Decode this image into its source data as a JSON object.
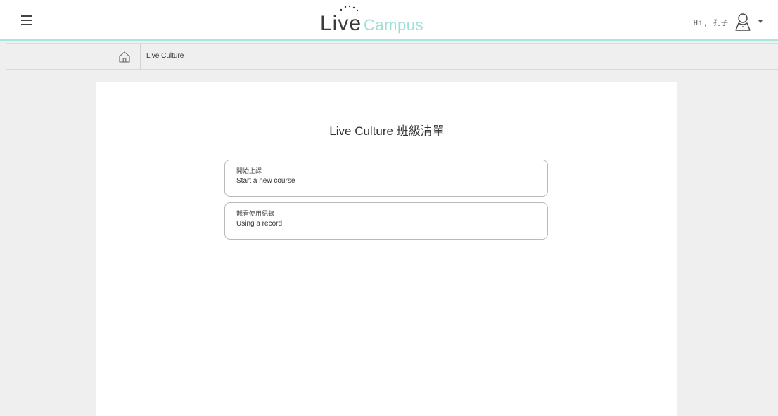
{
  "header": {
    "logo_live": "Live",
    "logo_campus": "Campus",
    "greeting": "Hi, 孔子"
  },
  "breadcrumb": {
    "current": "Live Culture"
  },
  "main": {
    "title": "Live Culture 班級清單",
    "options": [
      {
        "zh": "開始上課",
        "en": "Start a new course"
      },
      {
        "zh": "觀看使用紀錄",
        "en": "Using a record"
      }
    ]
  },
  "colors": {
    "accent": "#a8e6dd",
    "logo_campus": "#9ee0d6",
    "background": "#efefef",
    "card": "#ffffff"
  },
  "icons": [
    "menu-icon",
    "user-icon",
    "home-icon",
    "caret-down-icon"
  ]
}
